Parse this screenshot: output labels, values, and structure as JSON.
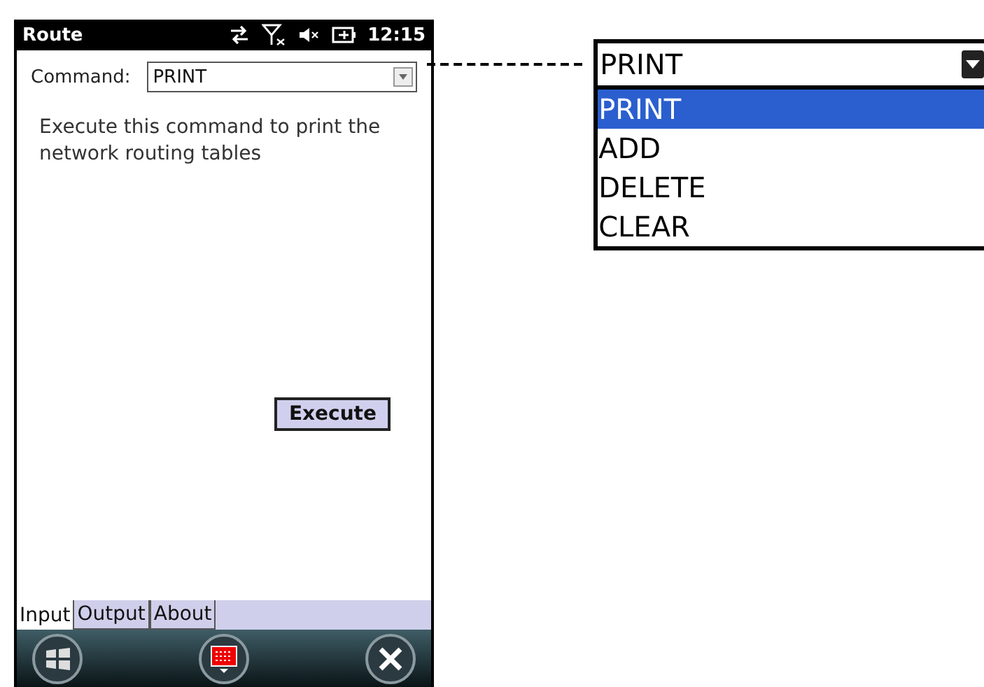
{
  "window": {
    "title": "Route",
    "time": "12:15"
  },
  "command": {
    "label": "Command:",
    "value": "PRINT"
  },
  "description": "Execute this command to print the network routing tables",
  "execute_button": "Execute",
  "tabs": [
    {
      "label": "Input",
      "selected": true
    },
    {
      "label": "Output",
      "selected": false
    },
    {
      "label": "About",
      "selected": false
    }
  ],
  "dropdown_callout": {
    "value": "PRINT",
    "options": [
      {
        "label": "PRINT",
        "selected": true
      },
      {
        "label": "ADD",
        "selected": false
      },
      {
        "label": "DELETE",
        "selected": false
      },
      {
        "label": "CLEAR",
        "selected": false
      }
    ]
  }
}
